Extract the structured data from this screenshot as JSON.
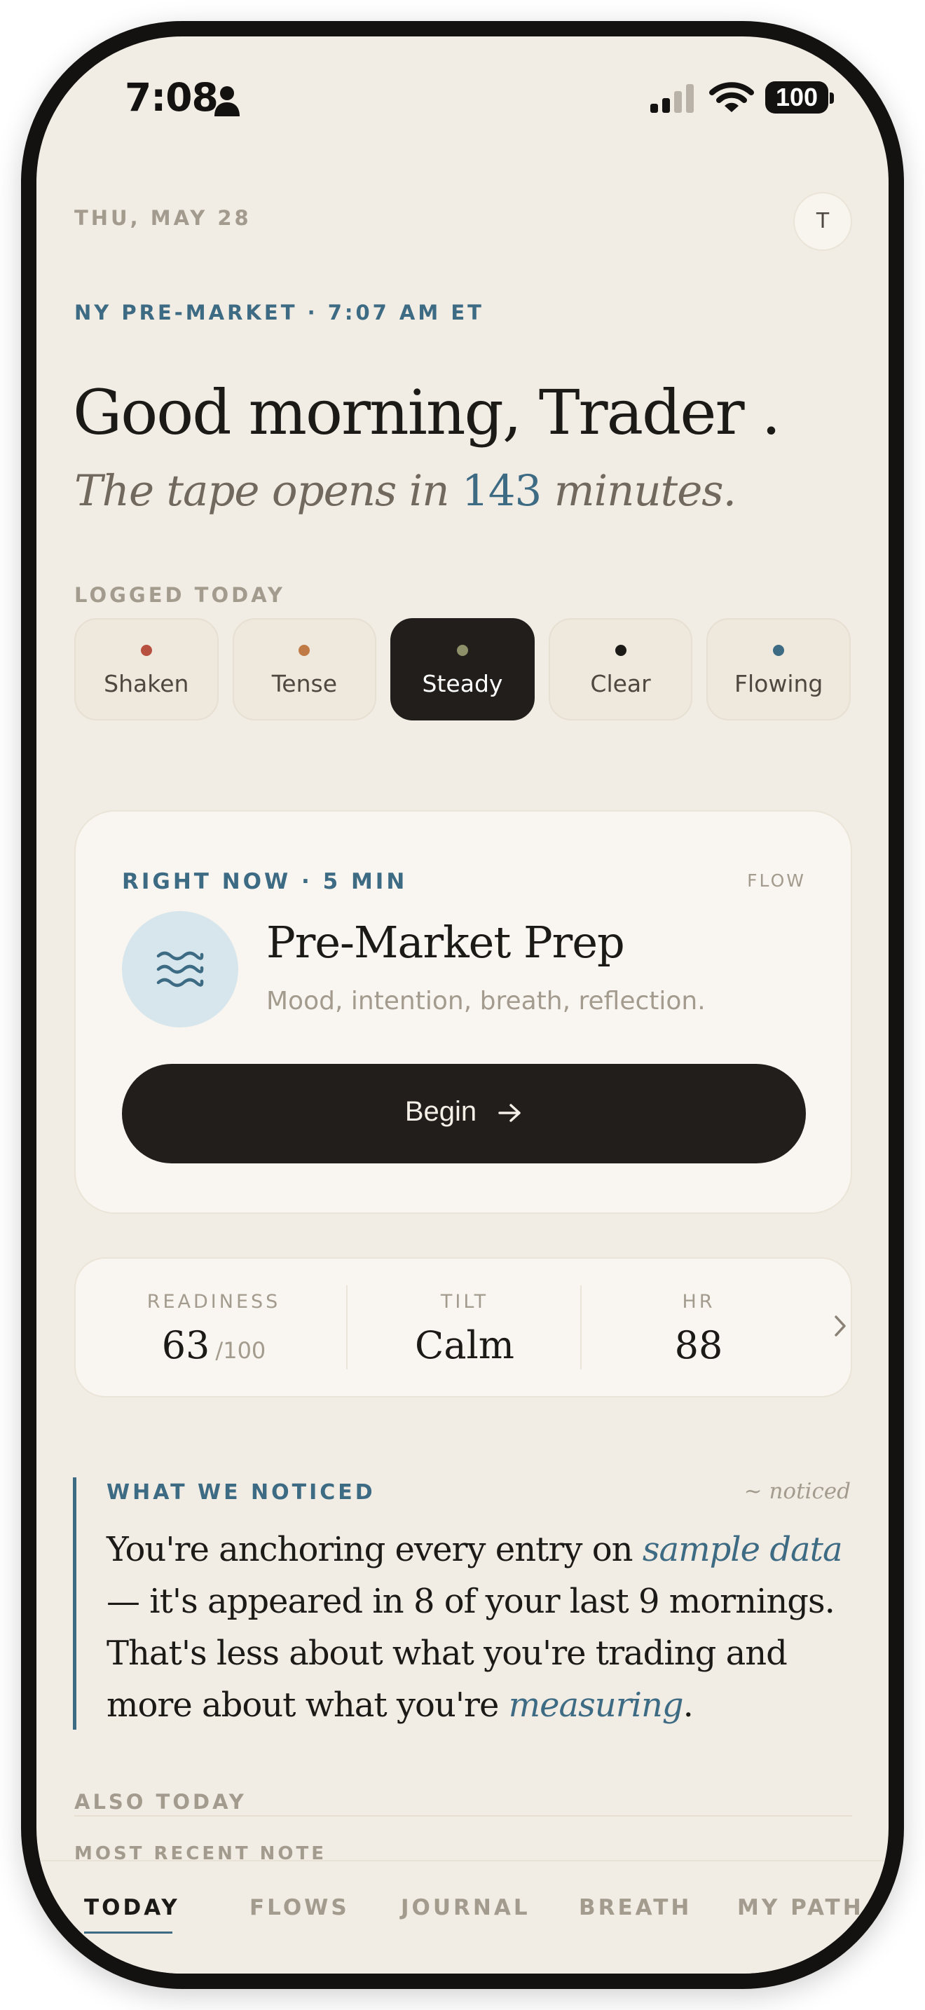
{
  "status_bar": {
    "time": "7:08",
    "battery": "100"
  },
  "header": {
    "date": "THU, MAY 28",
    "avatar_initial": "T",
    "session": "NY PRE-MARKET · 7:07 AM ET",
    "greeting": "Good morning, Trader .",
    "subtitle_pre": "The tape opens in ",
    "subtitle_num": "143",
    "subtitle_post": " minutes."
  },
  "mood": {
    "label": "LOGGED TODAY",
    "selected": "Steady",
    "items": [
      {
        "label": "Shaken",
        "color": "#b8503f"
      },
      {
        "label": "Tense",
        "color": "#c07a45"
      },
      {
        "label": "Steady",
        "color": "#8d9068"
      },
      {
        "label": "Clear",
        "color": "#1c1a17"
      },
      {
        "label": "Flowing",
        "color": "#3d6b84"
      }
    ]
  },
  "flow_card": {
    "eyebrow": "RIGHT NOW · 5 MIN",
    "tag": "FLOW",
    "title": "Pre-Market Prep",
    "description": "Mood, intention, breath, reflection.",
    "button_label": "Begin",
    "icon": "waves-icon"
  },
  "stats": {
    "readiness_label": "READINESS",
    "readiness_value": "63",
    "readiness_unit": "/100",
    "tilt_label": "TILT",
    "tilt_value": "Calm",
    "hr_label": "HR",
    "hr_value": "88"
  },
  "noticed": {
    "label": "WHAT WE NOTICED",
    "tag": "~ noticed",
    "t1": "You're anchoring every entry on ",
    "e1": "sample data",
    "t2": " — it's appeared in 8 of your last 9 mornings. That's less about what you're trading and more about what you're ",
    "e2": "measuring",
    "t3": "."
  },
  "also_today": {
    "label": "ALSO TODAY",
    "recent_label": "MOST RECENT NOTE"
  },
  "tabs": {
    "active": "TODAY",
    "items": [
      "TODAY",
      "FLOWS",
      "JOURNAL",
      "BREATH",
      "MY PATH"
    ]
  },
  "colors": {
    "accent": "#3d6b84",
    "background": "#f1ece4",
    "ink": "#1c1a17",
    "muted": "#a39b8e"
  }
}
